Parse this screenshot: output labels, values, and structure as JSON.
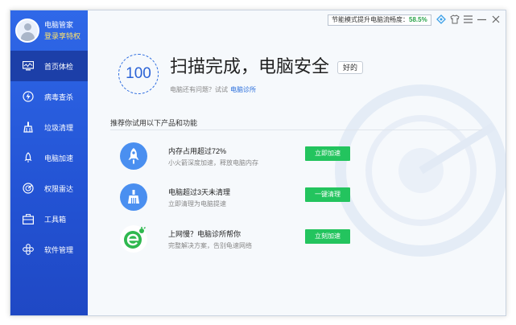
{
  "profile": {
    "name": "电脑管家",
    "login_link": "登录享特权",
    "avatar_icon": "user-avatar-icon"
  },
  "sidebar": {
    "items": [
      {
        "label": "首页体检",
        "icon": "monitor-icon",
        "active": true
      },
      {
        "label": "病毒查杀",
        "icon": "lightning-shield-icon",
        "active": false
      },
      {
        "label": "垃圾清理",
        "icon": "broom-icon",
        "active": false
      },
      {
        "label": "电脑加速",
        "icon": "rocket-icon",
        "active": false
      },
      {
        "label": "权限雷达",
        "icon": "radar-icon",
        "active": false
      },
      {
        "label": "工具箱",
        "icon": "toolbox-icon",
        "active": false
      },
      {
        "label": "软件管理",
        "icon": "apps-icon",
        "active": false
      }
    ]
  },
  "titlebar": {
    "promo_label": "节能模式提升电脑流畅度：",
    "promo_value": "58.5%",
    "icons": [
      "diamond-icon",
      "skin-shirt-icon",
      "menu-icon",
      "minimize-icon",
      "close-icon"
    ]
  },
  "main": {
    "score": "100",
    "headline": "扫描完成，电脑安全",
    "rating": "好的",
    "subline_text": "电脑还有问题？试试",
    "subline_link": "电脑诊所",
    "section_title": "推荐你试用以下产品和功能",
    "recommendations": [
      {
        "title": "内存占用超过72%",
        "desc": "小火箭深度加速，释放电脑内存",
        "button": "立即加速",
        "icon": "rocket-icon"
      },
      {
        "title": "电脑超过3天未清理",
        "desc": "立即清理为电脑提速",
        "button": "一键清理",
        "icon": "broom-icon"
      },
      {
        "title": "上网慢？电脑诊所帮你",
        "desc": "完整解决方案，告别龟速网络",
        "button": "立刻加速",
        "icon": "browser-e-icon"
      }
    ]
  },
  "colors": {
    "sidebar": "#2556d8",
    "sidebar_active": "#1c3fa8",
    "accent_blue": "#2b63d6",
    "button_green": "#23c45e",
    "badge_blue": "#4a8ff0"
  }
}
